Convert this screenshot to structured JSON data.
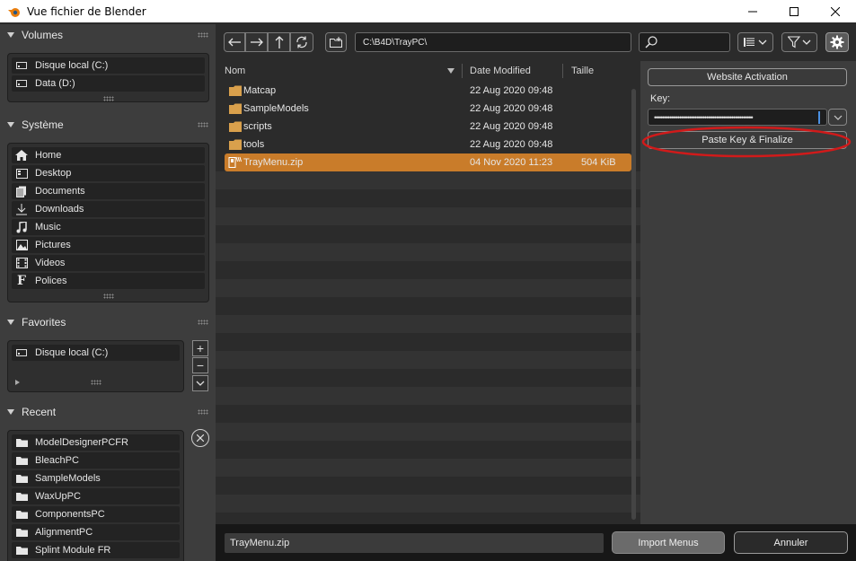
{
  "window": {
    "title": "Vue fichier de Blender"
  },
  "sidebar": {
    "volumes": {
      "title": "Volumes",
      "items": [
        {
          "label": "Disque local (C:)",
          "icon": "drive-icon"
        },
        {
          "label": "Data (D:)",
          "icon": "drive-icon"
        }
      ]
    },
    "system": {
      "title": "Système",
      "items": [
        {
          "label": "Home",
          "icon": "home-icon"
        },
        {
          "label": "Desktop",
          "icon": "desktop-icon"
        },
        {
          "label": "Documents",
          "icon": "documents-icon"
        },
        {
          "label": "Downloads",
          "icon": "download-icon"
        },
        {
          "label": "Music",
          "icon": "music-icon"
        },
        {
          "label": "Pictures",
          "icon": "image-icon"
        },
        {
          "label": "Videos",
          "icon": "film-icon"
        },
        {
          "label": "Polices",
          "icon": "font-icon"
        }
      ]
    },
    "favorites": {
      "title": "Favorites",
      "items": [
        {
          "label": "Disque local (C:)",
          "icon": "drive-icon"
        }
      ]
    },
    "recent": {
      "title": "Recent",
      "items": [
        {
          "label": "ModelDesignerPCFR",
          "icon": "folder-icon"
        },
        {
          "label": "BleachPC",
          "icon": "folder-icon"
        },
        {
          "label": "SampleModels",
          "icon": "folder-icon"
        },
        {
          "label": "WaxUpPC",
          "icon": "folder-icon"
        },
        {
          "label": "ComponentsPC",
          "icon": "folder-icon"
        },
        {
          "label": "AlignmentPC",
          "icon": "folder-icon"
        },
        {
          "label": "Splint Module FR",
          "icon": "folder-icon"
        }
      ]
    }
  },
  "toolbar": {
    "path": "C:\\B4D\\TrayPC\\",
    "search_placeholder": ""
  },
  "filelist": {
    "columns": {
      "name": "Nom",
      "date": "Date Modified",
      "size": "Taille"
    },
    "rows": [
      {
        "name": "Matcap",
        "date": "22 Aug 2020 09:48",
        "size": "",
        "type": "folder"
      },
      {
        "name": "SampleModels",
        "date": "22 Aug 2020 09:48",
        "size": "",
        "type": "folder"
      },
      {
        "name": "scripts",
        "date": "22 Aug 2020 09:48",
        "size": "",
        "type": "folder"
      },
      {
        "name": "tools",
        "date": "22 Aug 2020 09:48",
        "size": "",
        "type": "folder"
      },
      {
        "name": "TrayMenu.zip",
        "date": "04 Nov 2020 11:23",
        "size": "504 KiB",
        "type": "zip",
        "selected": true
      }
    ]
  },
  "right_panel": {
    "website_activation": "Website Activation",
    "key_label": "Key:",
    "key_value": "•••••••••••••••••••••••••••••••••••••••••••••••••••",
    "paste_button": "Paste Key & Finalize"
  },
  "bottom": {
    "filename": "TrayMenu.zip",
    "import_button": "Import Menus",
    "cancel_button": "Annuler"
  },
  "colors": {
    "selection": "#c97c2a",
    "highlight_ellipse": "#d11a1a",
    "accent_blue": "#4a90e2"
  }
}
